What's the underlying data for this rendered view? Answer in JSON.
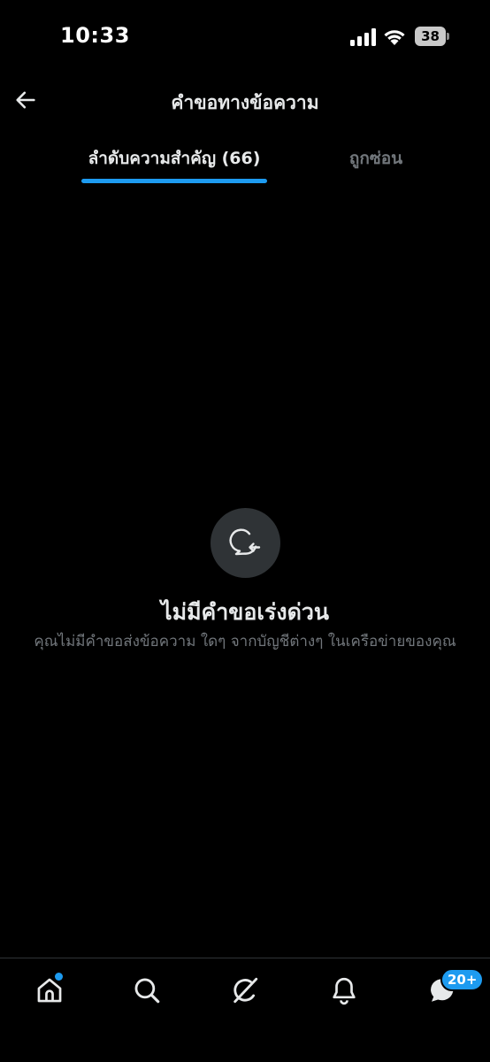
{
  "status_bar": {
    "time": "10:33",
    "battery": "38",
    "icons": [
      "signal-icon",
      "wifi-icon",
      "battery-icon"
    ]
  },
  "header": {
    "title": "คำขอทางข้อความ",
    "back_icon": "arrow-left-icon"
  },
  "tabs": [
    {
      "label": "ลำดับความสำคัญ (66)",
      "selected": true
    },
    {
      "label": "ถูกซ่อน",
      "selected": false
    }
  ],
  "empty_state": {
    "icon": "message-request-icon",
    "title": "ไม่มีคำขอเร่งด่วน",
    "description": "คุณไม่มีคำขอส่งข้อความ ใดๆ จากบัญชีต่างๆ ในเครือข่ายของคุณ"
  },
  "bottom_nav": {
    "items": [
      "home-icon",
      "search-icon",
      "grok-icon",
      "bell-icon",
      "messages-icon"
    ],
    "messages_badge": "20+"
  },
  "colors": {
    "background": "#000000",
    "accent": "#1d9bf0",
    "text_primary": "#e7e9ea",
    "text_secondary": "#71767b",
    "icon_circle": "#2f3336"
  }
}
